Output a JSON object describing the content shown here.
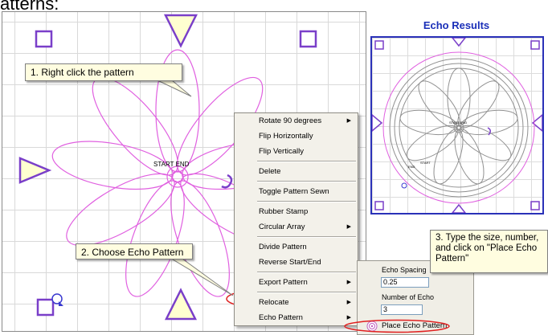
{
  "heading_fragment": "atterns:",
  "canvas": {
    "start_end_label": "START END"
  },
  "echo_results": {
    "title": "Echo Results",
    "small_label_1": "START END",
    "small_label_2": "END",
    "small_label_3": "START"
  },
  "callouts": {
    "step1": "1. Right click the pattern",
    "step2": "2. Choose Echo Pattern",
    "step3": "3. Type the size, number, and click on \"Place Echo Pattern\""
  },
  "context_menu": {
    "items": [
      {
        "label": "Rotate 90 degrees",
        "submenu": true
      },
      {
        "label": "Flip Horizontally",
        "submenu": false
      },
      {
        "label": "Flip Vertically",
        "submenu": false
      },
      {
        "label": "Delete",
        "submenu": false
      },
      {
        "label": "Toggle Pattern Sewn",
        "submenu": false
      },
      {
        "label": "Rubber Stamp",
        "submenu": false
      },
      {
        "label": "Circular Array",
        "submenu": true
      },
      {
        "label": "Divide Pattern",
        "submenu": false
      },
      {
        "label": "Reverse Start/End",
        "submenu": false
      },
      {
        "label": "Export Pattern",
        "submenu": true
      },
      {
        "label": "Relocate",
        "submenu": true
      },
      {
        "label": "Echo Pattern",
        "submenu": true
      }
    ],
    "submenu_arrow": "▶"
  },
  "echo_panel": {
    "spacing_label": "Echo Spacing",
    "spacing_value": "0.25",
    "number_label": "Number of Echo",
    "number_value": "3",
    "place_button": "Place Echo Pattern"
  },
  "colors": {
    "pattern": "#e060e0",
    "marker": "#7a3fc9",
    "marker_fill": "#ffffd0",
    "highlight": "#e02020",
    "echo_title": "#1a2fb8",
    "echo_frame": "#2a31b8"
  },
  "icons": {
    "square_marker": "square-outline-icon",
    "triangle_marker": "triangle-outline-icon",
    "circle_marker": "circle-outline-icon",
    "echo_icon": "echo-pattern-icon"
  }
}
